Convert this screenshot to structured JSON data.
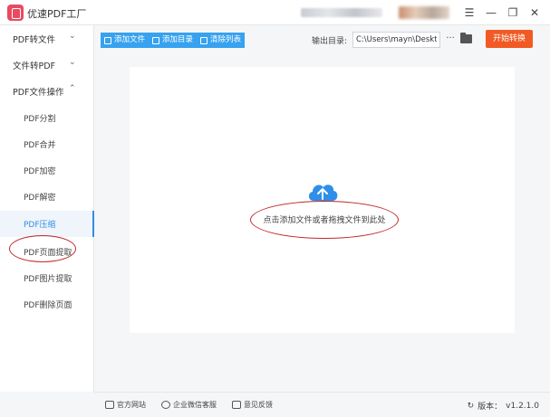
{
  "window": {
    "title": "优速PDF工厂",
    "menu_glyph": "☰",
    "minimize_glyph": "—",
    "restore_glyph": "❐",
    "close_glyph": "✕"
  },
  "sidebar": {
    "groups": [
      {
        "label": "PDF转文件",
        "chevron": "⌄"
      },
      {
        "label": "文件转PDF",
        "chevron": "⌄"
      },
      {
        "label": "PDF文件操作",
        "chevron": "⌃"
      }
    ],
    "items": [
      {
        "label": "PDF分割"
      },
      {
        "label": "PDF合并"
      },
      {
        "label": "PDF加密"
      },
      {
        "label": "PDF解密"
      },
      {
        "label": "PDF压缩",
        "active": true
      },
      {
        "label": "PDF页面提取"
      },
      {
        "label": "PDF图片提取"
      },
      {
        "label": "PDF删除页面"
      }
    ]
  },
  "toolbar": {
    "add_file": "添加文件",
    "add_folder": "添加目录",
    "clear_list": "清除列表",
    "output_label": "输出目录:",
    "output_path": "C:\\Users\\mayn\\Desktop",
    "more": "···",
    "start": "开始转换"
  },
  "drop": {
    "hint": "点击添加文件或者拖拽文件到此处"
  },
  "footer": {
    "website": "官方网站",
    "wechat": "企业微信客服",
    "feedback": "意见反馈",
    "version_label": "版本：",
    "version": "v1.2.1.0"
  },
  "colors": {
    "primary": "#37a2ef",
    "accent": "#f15a24",
    "annotation": "#c0282a",
    "logo": "#e84a5f"
  }
}
